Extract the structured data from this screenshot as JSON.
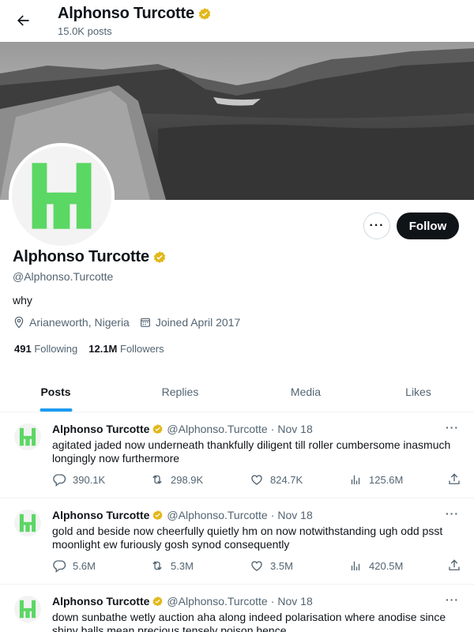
{
  "header": {
    "title": "Alphonso Turcotte",
    "post_count": "15.0K posts"
  },
  "banner": {
    "alt": "mountain landscape"
  },
  "profile": {
    "name": "Alphonso Turcotte",
    "handle": "@Alphonso.Turcotte",
    "bio": "why",
    "location": "Arianeworth, Nigeria",
    "joined": "Joined April 2017",
    "following_count": "491",
    "following_label": "Following",
    "followers_count": "12.1M",
    "followers_label": "Followers",
    "follow_label": "Follow",
    "more_label": "···"
  },
  "tabs": [
    {
      "label": "Posts",
      "active": true
    },
    {
      "label": "Replies",
      "active": false
    },
    {
      "label": "Media",
      "active": false
    },
    {
      "label": "Likes",
      "active": false
    }
  ],
  "posts": [
    {
      "name": "Alphonso Turcotte",
      "handle": "@Alphonso.Turcotte",
      "date": "Nov 18",
      "text": "agitated jaded now underneath thankfully diligent till roller cumbersome inasmuch longingly now furthermore",
      "replies": "390.1K",
      "reposts": "298.9K",
      "likes": "824.7K",
      "views": "125.6M"
    },
    {
      "name": "Alphonso Turcotte",
      "handle": "@Alphonso.Turcotte",
      "date": "Nov 18",
      "text": "gold and beside now cheerfully quietly hm on now notwithstanding ugh odd psst moonlight ew furiously gosh synod consequently",
      "replies": "5.6M",
      "reposts": "5.3M",
      "likes": "3.5M",
      "views": "420.5M"
    },
    {
      "name": "Alphonso Turcotte",
      "handle": "@Alphonso.Turcotte",
      "date": "Nov 18",
      "text": "down sunbathe wetly auction aha along indeed polarisation where anodise since shiny balls mean precious tensely poison hence",
      "replies": "",
      "reposts": "",
      "likes": "",
      "views": ""
    }
  ],
  "colors": {
    "accent": "#1d9bf0",
    "verified": "#e2b719",
    "logo_green": "#5bd764",
    "follow_bg": "#0f1419"
  }
}
